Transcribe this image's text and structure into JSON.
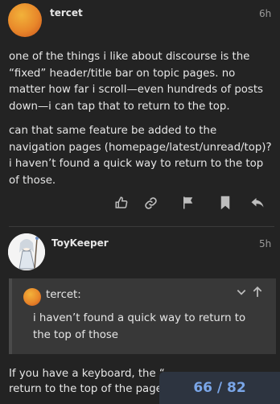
{
  "post1": {
    "username": "tercet",
    "time": "6h",
    "paragraphs": [
      "one of the things i like about discourse is the “fixed” header/title bar on topic pages. no matter how far i scroll—even hundreds of posts down—i can tap that to return to the top.",
      "can that same feature be added to the navigation pages (homepage/latest/unread/top)? i haven’t found a quick way to return to the top of those."
    ],
    "actions": [
      "like-icon",
      "link-icon",
      "flag-icon",
      "bookmark-icon",
      "reply-icon"
    ]
  },
  "post2": {
    "username": "ToyKeeper",
    "time": "5h",
    "quote": {
      "username": "tercet:",
      "text": "i haven’t found a quick way to return to the top of those"
    },
    "text": "If you have a keyboard, the “",
    "text2": "return to the top of the page"
  },
  "timeline": {
    "label": "66 / 82"
  }
}
